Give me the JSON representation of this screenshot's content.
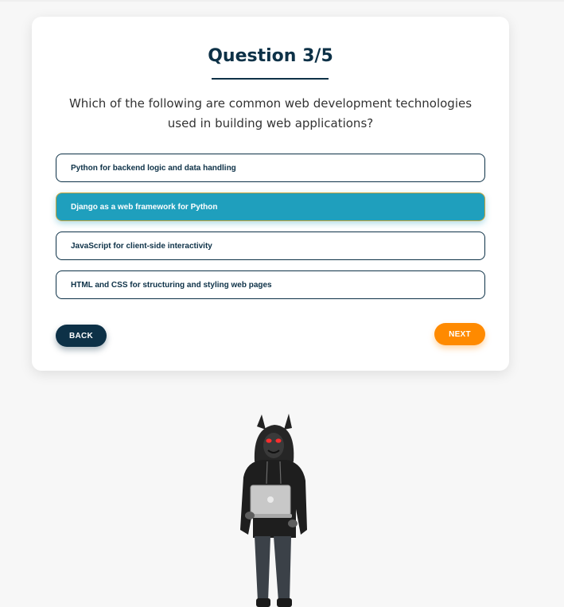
{
  "quiz": {
    "title": "Question 3/5",
    "question": "Which of the following are common web development technologies used in building web applications?",
    "options": [
      {
        "label": "Python for backend logic and data handling",
        "selected": false
      },
      {
        "label": "Django as a web framework for Python",
        "selected": true
      },
      {
        "label": "JavaScript for client-side interactivity",
        "selected": false
      },
      {
        "label": "HTML and CSS for structuring and styling web pages",
        "selected": false
      }
    ],
    "back_label": "BACK",
    "next_label": "NEXT"
  },
  "colors": {
    "primary": "#0d3147",
    "selected": "#1f9fbd",
    "accent": "#ff8a00"
  },
  "illustration": {
    "icon": "hooded-hacker-with-laptop-illustration"
  }
}
